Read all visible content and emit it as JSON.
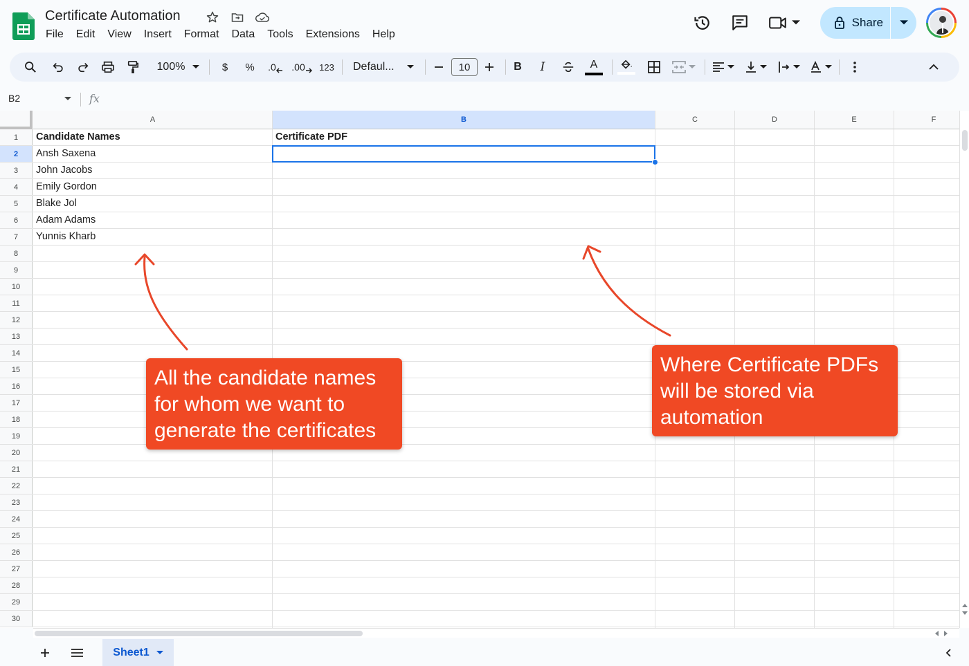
{
  "doc": {
    "title": "Certificate Automation"
  },
  "menu": [
    "File",
    "Edit",
    "View",
    "Insert",
    "Format",
    "Data",
    "Tools",
    "Extensions",
    "Help"
  ],
  "share": {
    "label": "Share"
  },
  "toolbar": {
    "zoom": "100%",
    "currency": "$",
    "percent": "%",
    "decrease_decimal": ".0",
    "increase_decimal": ".00",
    "number_format": "123",
    "font": "Defaul...",
    "font_size": "10",
    "bold": "B",
    "italic": "I",
    "text_color": "A"
  },
  "formula_bar": {
    "cell_ref": "B2",
    "fx": "fx",
    "value": ""
  },
  "columns": [
    "A",
    "B",
    "C",
    "D",
    "E",
    "F"
  ],
  "selected": {
    "column": "B",
    "row": 2
  },
  "rows": [
    {
      "n": "1",
      "a": "Candidate Names",
      "b": "Certificate PDF"
    },
    {
      "n": "2",
      "a": "Ansh Saxena",
      "b": ""
    },
    {
      "n": "3",
      "a": "John Jacobs",
      "b": ""
    },
    {
      "n": "4",
      "a": "Emily Gordon",
      "b": ""
    },
    {
      "n": "5",
      "a": "Blake Jol",
      "b": ""
    },
    {
      "n": "6",
      "a": "Adam Adams",
      "b": ""
    },
    {
      "n": "7",
      "a": "Yunnis Kharb",
      "b": ""
    },
    {
      "n": "8",
      "a": "",
      "b": ""
    },
    {
      "n": "9",
      "a": "",
      "b": ""
    },
    {
      "n": "10",
      "a": "",
      "b": ""
    },
    {
      "n": "11",
      "a": "",
      "b": ""
    },
    {
      "n": "12",
      "a": "",
      "b": ""
    },
    {
      "n": "13",
      "a": "",
      "b": ""
    },
    {
      "n": "14",
      "a": "",
      "b": ""
    },
    {
      "n": "15",
      "a": "",
      "b": ""
    },
    {
      "n": "16",
      "a": "",
      "b": ""
    },
    {
      "n": "17",
      "a": "",
      "b": ""
    },
    {
      "n": "18",
      "a": "",
      "b": ""
    },
    {
      "n": "19",
      "a": "",
      "b": ""
    },
    {
      "n": "20",
      "a": "",
      "b": ""
    },
    {
      "n": "21",
      "a": "",
      "b": ""
    },
    {
      "n": "22",
      "a": "",
      "b": ""
    },
    {
      "n": "23",
      "a": "",
      "b": ""
    },
    {
      "n": "24",
      "a": "",
      "b": ""
    },
    {
      "n": "25",
      "a": "",
      "b": ""
    },
    {
      "n": "26",
      "a": "",
      "b": ""
    },
    {
      "n": "27",
      "a": "",
      "b": ""
    },
    {
      "n": "28",
      "a": "",
      "b": ""
    },
    {
      "n": "29",
      "a": "",
      "b": ""
    },
    {
      "n": "30",
      "a": "",
      "b": ""
    }
  ],
  "sheets": [
    {
      "name": "Sheet1"
    }
  ],
  "callouts": {
    "left": [
      "All the candidate names",
      "for whom we want to",
      "generate the certificates"
    ],
    "right": [
      "Where Certificate PDFs",
      "will be stored via",
      "automation"
    ]
  },
  "colors": {
    "accent": "#0b57d0",
    "callout": "#f04924",
    "share_bg": "#c2e7ff",
    "selection": "#1a73e8"
  }
}
